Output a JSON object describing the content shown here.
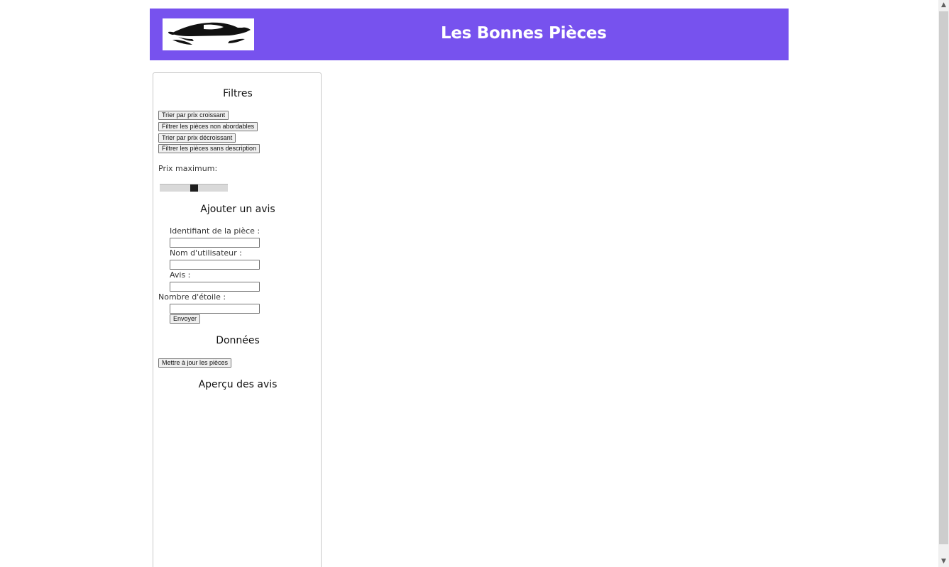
{
  "header": {
    "title": "Les Bonnes Pièces",
    "logo_icon": "sports-car-logo"
  },
  "filters": {
    "title": "Filtres",
    "buttons": [
      "Trier par prix croissant",
      "Filtrer les pièces non abordables",
      "Trier par prix décroissant",
      "Filtrer les pièces sans description"
    ],
    "price_max_label": "Prix maximum:",
    "price_max_slider_fraction": 0.5
  },
  "review_form": {
    "title": "Ajouter un avis",
    "piece_id_label": "Identifiant de la pièce :",
    "piece_id_value": "",
    "username_label": "Nom d'utilisateur :",
    "username_value": "",
    "review_label": "Avis :",
    "review_value": "",
    "stars_label": "Nombre d'étoile :",
    "stars_value": "",
    "submit_label": "Envoyer"
  },
  "data_section": {
    "title": "Données",
    "update_button": "Mettre à jour les pièces"
  },
  "reviews_preview": {
    "title": "Aperçu des avis"
  },
  "colors": {
    "header_background": "#7752ee",
    "header_text": "#ffffff"
  }
}
